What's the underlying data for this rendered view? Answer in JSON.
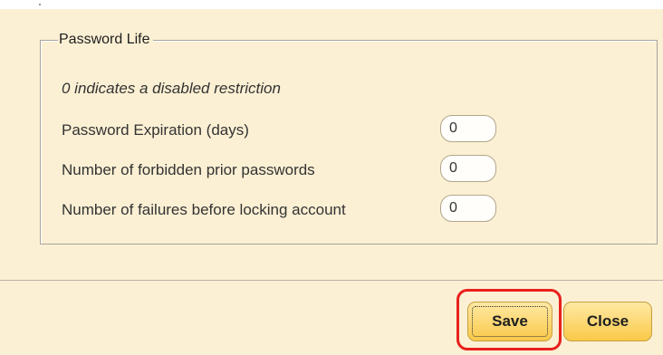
{
  "password_life": {
    "title": "Password Life",
    "hint": "0 indicates a disabled restriction",
    "fields": [
      {
        "label": "Password Expiration (days)",
        "value": "0"
      },
      {
        "label": "Number of forbidden prior passwords",
        "value": "0"
      },
      {
        "label": "Number of failures before locking account",
        "value": "0"
      }
    ]
  },
  "footer": {
    "save_label": "Save",
    "close_label": "Close"
  },
  "colors": {
    "panel_background": "#fcf0d4",
    "button_fill": "#f9c949",
    "highlight": "#e8201c"
  }
}
